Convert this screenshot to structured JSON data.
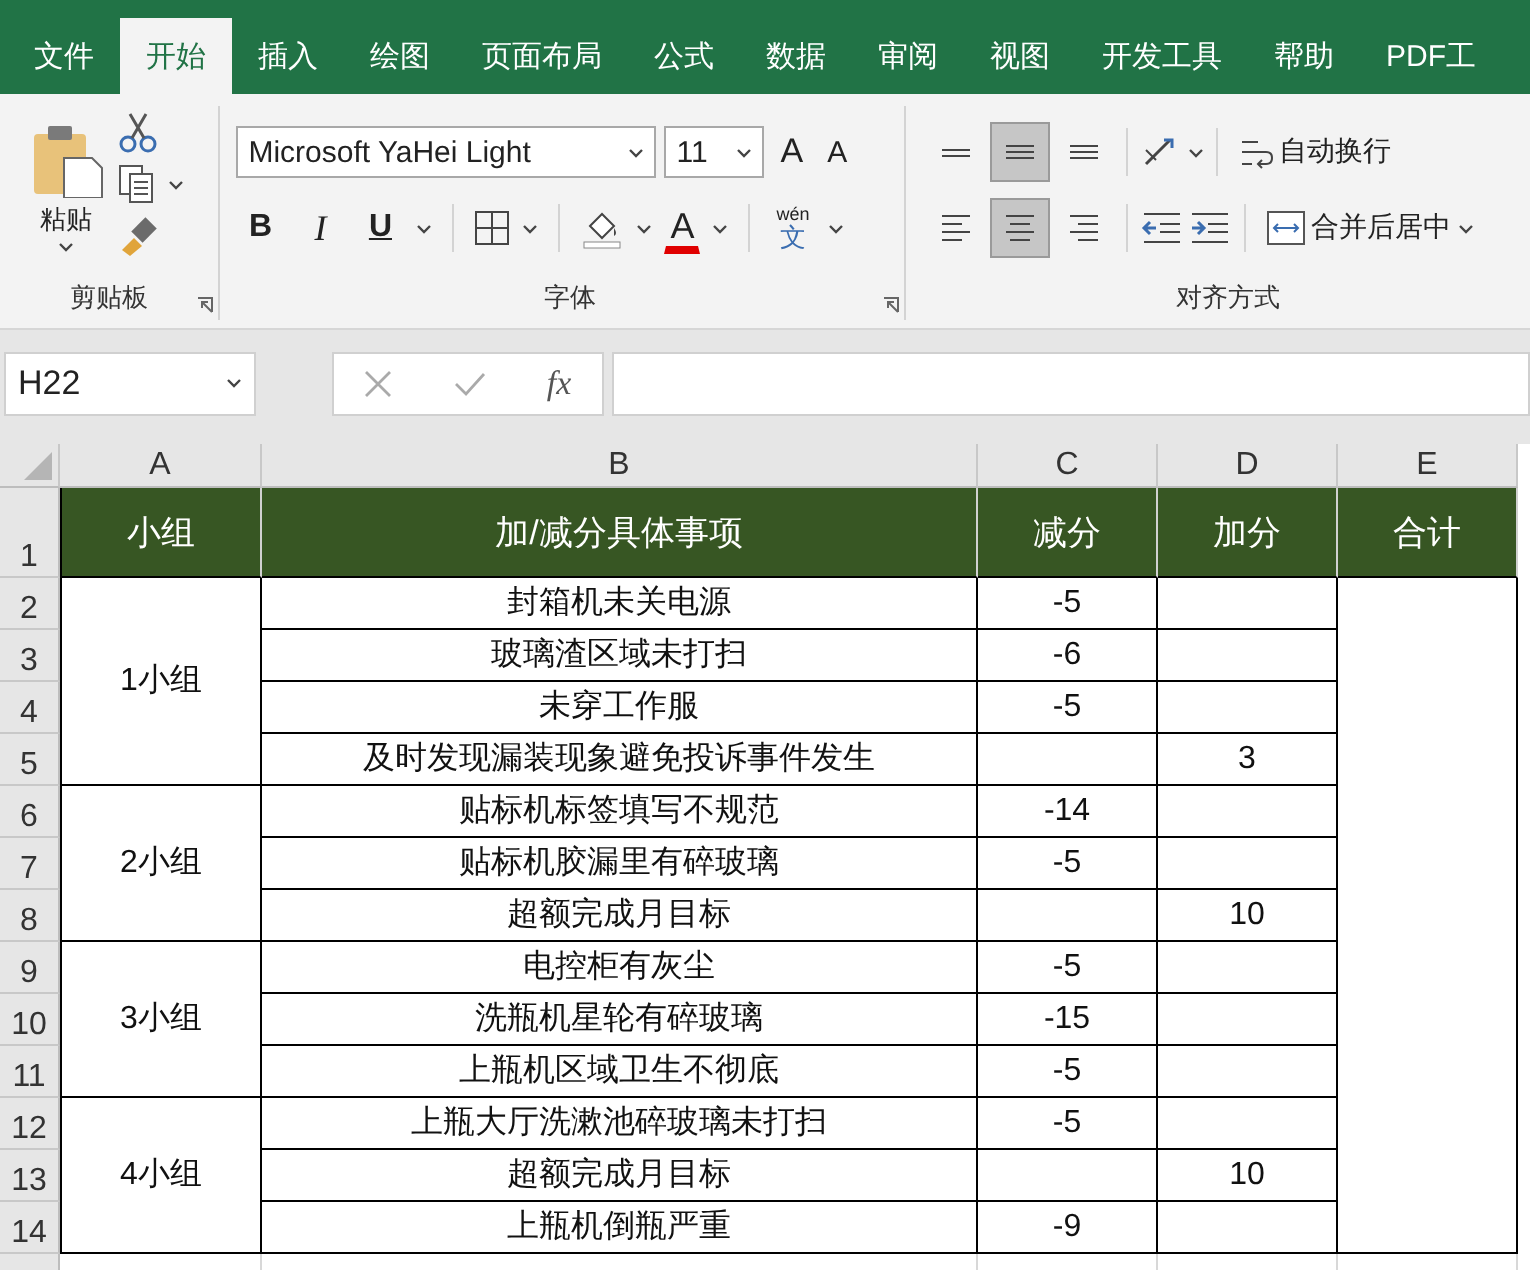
{
  "tabs": [
    {
      "label": "文件",
      "selected": false
    },
    {
      "label": "开始",
      "selected": true
    },
    {
      "label": "插入",
      "selected": false
    },
    {
      "label": "绘图",
      "selected": false
    },
    {
      "label": "页面布局",
      "selected": false
    },
    {
      "label": "公式",
      "selected": false
    },
    {
      "label": "数据",
      "selected": false
    },
    {
      "label": "审阅",
      "selected": false
    },
    {
      "label": "视图",
      "selected": false
    },
    {
      "label": "开发工具",
      "selected": false
    },
    {
      "label": "帮助",
      "selected": false
    },
    {
      "label": "PDF工",
      "selected": false
    }
  ],
  "ribbon": {
    "clipboard": {
      "paste_label": "粘贴",
      "group_label": "剪贴板"
    },
    "font": {
      "font_name": "Microsoft YaHei Light",
      "font_size": "11",
      "grow_label": "A",
      "shrink_label": "A",
      "bold_label": "B",
      "italic_label": "I",
      "underline_label": "U",
      "color_label": "A",
      "phonetic_top": "wén",
      "phonetic_bottom": "文",
      "group_label": "字体"
    },
    "alignment": {
      "vertical": [
        {
          "kind": "top",
          "selected": false
        },
        {
          "kind": "middle",
          "selected": true
        },
        {
          "kind": "bottom",
          "selected": false
        }
      ],
      "horizontal": [
        {
          "kind": "left",
          "selected": false
        },
        {
          "kind": "center",
          "selected": true
        },
        {
          "kind": "right",
          "selected": false
        }
      ],
      "wrap_label": "自动换行",
      "merge_label": "合并后居中",
      "group_label": "对齐方式"
    }
  },
  "formula_bar": {
    "name_box": "H22",
    "function_label": "fx"
  },
  "sheet": {
    "columns": [
      "A",
      "B",
      "C",
      "D",
      "E"
    ],
    "header": [
      "小组",
      "加/减分具体事项",
      "减分",
      "加分",
      "合计"
    ],
    "groups": [
      {
        "name": "1小组",
        "items": [
          {
            "row": "2",
            "item": "封箱机未关电源",
            "deduct": "-5"
          },
          {
            "row": "3",
            "item": "玻璃渣区域未打扫",
            "deduct": "-6"
          },
          {
            "row": "4",
            "item": "未穿工作服",
            "deduct": "-5"
          },
          {
            "row": "5",
            "item": "及时发现漏装现象避免投诉事件发生",
            "add": "3"
          }
        ]
      },
      {
        "name": "2小组",
        "items": [
          {
            "row": "6",
            "item": "贴标机标签填写不规范",
            "deduct": "-14"
          },
          {
            "row": "7",
            "item": "贴标机胶漏里有碎玻璃",
            "deduct": "-5"
          },
          {
            "row": "8",
            "item": "超额完成月目标",
            "add": "10"
          }
        ]
      },
      {
        "name": "3小组",
        "items": [
          {
            "row": "9",
            "item": "电控柜有灰尘",
            "deduct": "-5"
          },
          {
            "row": "10",
            "item": "洗瓶机星轮有碎玻璃",
            "deduct": "-15"
          },
          {
            "row": "11",
            "item": "上瓶机区域卫生不彻底",
            "deduct": "-5"
          }
        ]
      },
      {
        "name": "4小组",
        "items": [
          {
            "row": "12",
            "item": "上瓶大厅洗漱池碎玻璃未打扫",
            "deduct": "-5"
          },
          {
            "row": "13",
            "item": "超额完成月目标",
            "add": "10"
          },
          {
            "row": "14",
            "item": "上瓶机倒瓶严重",
            "deduct": "-9"
          }
        ]
      }
    ],
    "header_row": "1"
  }
}
